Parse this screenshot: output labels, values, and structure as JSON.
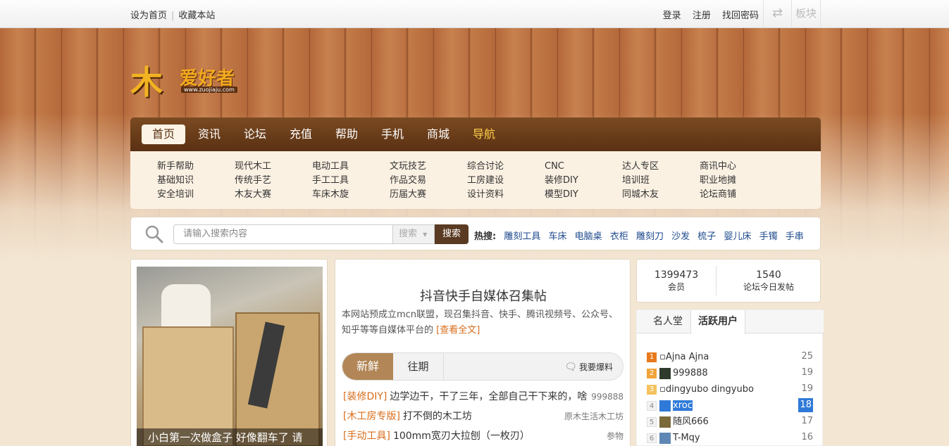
{
  "topbar": {
    "set_home": "设为首页",
    "bookmark": "收藏本站",
    "login": "登录",
    "register": "注册",
    "recover": "找回密码",
    "blocks": "板块"
  },
  "logo": {
    "mu": "木",
    "text": "爱好者",
    "url": "www.zuojiaju.com"
  },
  "nav": {
    "items": [
      "首页",
      "资讯",
      "论坛",
      "充值",
      "帮助",
      "手机",
      "商城",
      "导航"
    ]
  },
  "subnav": {
    "columns": [
      [
        "新手帮助",
        "基础知识",
        "安全培训"
      ],
      [
        "现代木工",
        "传统手艺",
        "木友大赛"
      ],
      [
        "电动工具",
        "手工工具",
        "车床木旋"
      ],
      [
        "文玩技艺",
        "作品交易",
        "历届大赛"
      ],
      [
        "综合讨论",
        "工房建设",
        "设计资料"
      ],
      [
        "CNC",
        "装修DIY",
        "模型DIY"
      ],
      [
        "达人专区",
        "培训班",
        "同城木友"
      ],
      [
        "商讯中心",
        "职业地摊",
        "论坛商铺"
      ]
    ]
  },
  "search": {
    "placeholder": "请输入搜索内容",
    "select": "搜索",
    "button": "搜索",
    "hot_label": "热搜:",
    "hot_words": [
      "雕刻工具",
      "车床",
      "电脑桌",
      "衣柜",
      "雕刻刀",
      "沙发",
      "梳子",
      "婴儿床",
      "手镯",
      "手串"
    ]
  },
  "photo": {
    "caption": "小白第一次做盒子 好像翻车了 请"
  },
  "feature": {
    "headline": "抖音快手自媒体召集帖",
    "intro": "本网站预成立mcn联盟，现召集抖音、快手、腾讯视频号、公众号、知乎等等自媒体平台的",
    "more": "[查看全文]"
  },
  "tabs": {
    "fresh": "新鲜",
    "past": "往期",
    "report": "我要爆料"
  },
  "posts": [
    {
      "category": "[装修DIY]",
      "title": "边学边干，干了三年，全部自己干下来的，啥",
      "author": "999888"
    },
    {
      "category": "[木工房专版]",
      "title": "打不倒的木工坊",
      "author": "原木生活木工坊"
    },
    {
      "category": "[手动工具]",
      "title": "100mm宽刃大拉刨（一枚刃）",
      "author": "参物"
    }
  ],
  "stats": {
    "members_value": "1399473",
    "members_label": "会员",
    "today_value": "1540",
    "today_label": "论坛今日发帖"
  },
  "ranking": {
    "tab_fame": "名人堂",
    "tab_active": "活跃用户",
    "items": [
      {
        "rank": "1",
        "name": "Ajna Ajna",
        "score": "25"
      },
      {
        "rank": "2",
        "name": "999888",
        "score": "19"
      },
      {
        "rank": "3",
        "name": "dingyubo dingyubo",
        "score": "19"
      },
      {
        "rank": "4",
        "name": "xroc",
        "score": "18"
      },
      {
        "rank": "5",
        "name": "随风666",
        "score": "17"
      },
      {
        "rank": "6",
        "name": "T-Mqy",
        "score": "16"
      }
    ]
  }
}
